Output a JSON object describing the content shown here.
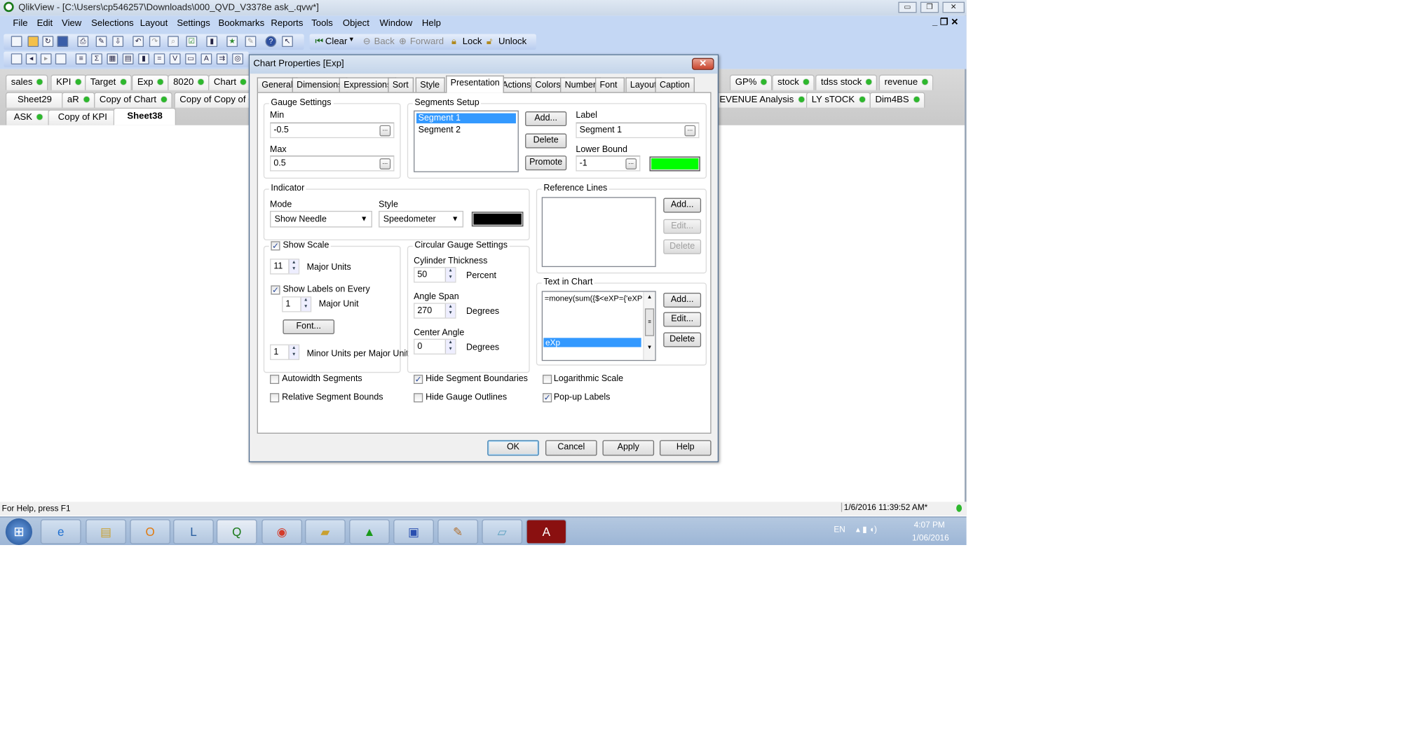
{
  "window": {
    "title": "QlikView - [C:\\Users\\cp546257\\Downloads\\000_QVD_V3378e ask_.qvw*]"
  },
  "menu": [
    "File",
    "Edit",
    "View",
    "Selections",
    "Layout",
    "Settings",
    "Bookmarks",
    "Reports",
    "Tools",
    "Object",
    "Window",
    "Help"
  ],
  "toolbar": {
    "clear": "Clear",
    "back": "Back",
    "forward": "Forward",
    "lock": "Lock",
    "unlock": "Unlock"
  },
  "sheet_tabs": {
    "row1": [
      "sales",
      "KPI",
      "Target",
      "Exp",
      "8020",
      "Chart",
      "GP%",
      "stock",
      "tdss stock",
      "revenue"
    ],
    "row2": [
      "Sheet29",
      "aR",
      "Copy of Chart",
      "Copy of Copy of C",
      "EVENUE Analysis",
      "LY sTOCK",
      "Dim4BS"
    ],
    "row3": [
      "ASK",
      "Copy of KPI",
      "Sheet38"
    ],
    "active": "Sheet38"
  },
  "dialog": {
    "title": "Chart Properties [Exp]",
    "tabs": [
      "General",
      "Dimensions",
      "Expressions",
      "Sort",
      "Style",
      "Presentation",
      "Actions",
      "Colors",
      "Number",
      "Font",
      "Layout",
      "Caption"
    ],
    "active_tab": "Presentation",
    "gauge_settings": {
      "title": "Gauge Settings",
      "min_label": "Min",
      "min": "-0.5",
      "max_label": "Max",
      "max": "0.5"
    },
    "segments": {
      "title": "Segments Setup",
      "items": [
        "Segment 1",
        "Segment 2"
      ],
      "selected": "Segment 1",
      "add": "Add...",
      "delete": "Delete",
      "promote": "Promote",
      "label_label": "Label",
      "label": "Segment 1",
      "lower_bound_label": "Lower Bound",
      "lower_bound": "-1",
      "color": "#00ff00"
    },
    "indicator": {
      "title": "Indicator",
      "mode_label": "Mode",
      "mode": "Show Needle",
      "style_label": "Style",
      "style": "Speedometer",
      "color": "#000000"
    },
    "reference_lines": {
      "title": "Reference Lines",
      "add": "Add...",
      "edit": "Edit...",
      "delete": "Delete"
    },
    "scale": {
      "show_scale": "Show Scale",
      "show_scale_checked": true,
      "major_units": "11",
      "major_units_label": "Major Units",
      "show_labels": "Show Labels on Every",
      "show_labels_checked": true,
      "label_every": "1",
      "major_unit_label": "Major Unit",
      "font": "Font...",
      "minor_units": "1",
      "minor_units_label": "Minor Units per Major Unit"
    },
    "circular": {
      "title": "Circular Gauge Settings",
      "thickness_label": "Cylinder Thickness",
      "thickness": "50",
      "percent": "Percent",
      "span_label": "Angle Span",
      "span": "270",
      "degrees": "Degrees",
      "center_label": "Center Angle",
      "center": "0"
    },
    "text_in_chart": {
      "title": "Text in Chart",
      "items": [
        "=money(sum({$<eXP={'eXP'}",
        "eXp"
      ],
      "selected": "eXp",
      "add": "Add...",
      "edit": "Edit...",
      "delete": "Delete"
    },
    "checks": [
      {
        "label": "Autowidth Segments",
        "checked": false
      },
      {
        "label": "Relative Segment Bounds",
        "checked": false
      },
      {
        "label": "Hide Segment Boundaries",
        "checked": true
      },
      {
        "label": "Hide Gauge Outlines",
        "checked": false
      },
      {
        "label": "Logarithmic Scale",
        "checked": false
      },
      {
        "label": "Pop-up Labels",
        "checked": true
      }
    ],
    "buttons": {
      "ok": "OK",
      "cancel": "Cancel",
      "apply": "Apply",
      "help": "Help"
    }
  },
  "status": {
    "help": "For Help, press F1",
    "timestamp": "1/6/2016 11:39:52 AM*"
  },
  "taskbar": {
    "lang": "EN",
    "time": "4:07 PM",
    "date": "1/06/2016"
  }
}
